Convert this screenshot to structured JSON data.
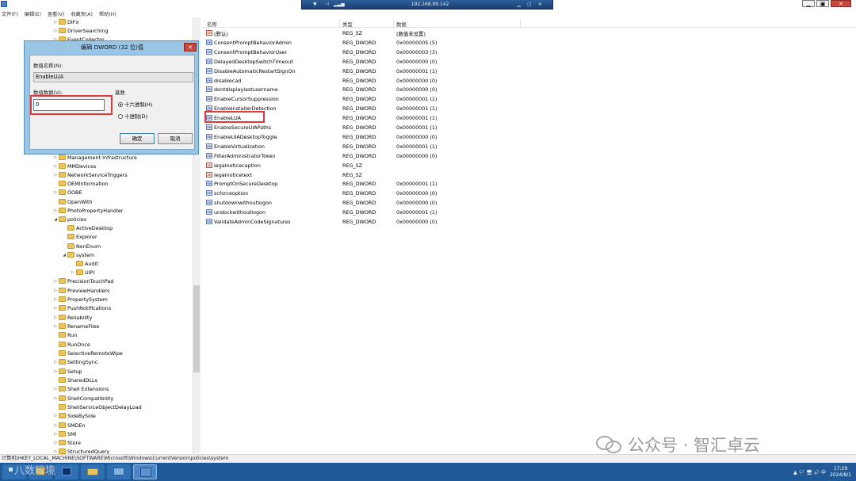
{
  "rdp_bar": {
    "pin_icon": "pin-icon",
    "signal_icon": "signal-icon",
    "host": "192.168.99.142"
  },
  "window_controls": {
    "minimize": "▁",
    "restore": "▣",
    "close": "✕"
  },
  "menu": [
    "文件(F)",
    "编辑(E)",
    "查看(V)",
    "收藏夹(A)",
    "帮助(H)"
  ],
  "tree": {
    "items": [
      {
        "label": "DIFx",
        "level": 0,
        "expander": "▷"
      },
      {
        "label": "DriverSearching",
        "level": 0,
        "expander": "▷"
      },
      {
        "label": "EventCollector",
        "level": 0,
        "expander": "▷"
      },
      {
        "label": "Management Infrastructure",
        "level": 0,
        "expander": "▷"
      },
      {
        "label": "MMDevices",
        "level": 0,
        "expander": "▷"
      },
      {
        "label": "NetworkServiceTriggers",
        "level": 0,
        "expander": "▷"
      },
      {
        "label": "OEMInformation",
        "level": 0,
        "expander": ""
      },
      {
        "label": "OOBE",
        "level": 0,
        "expander": "▷"
      },
      {
        "label": "OpenWith",
        "level": 0,
        "expander": ""
      },
      {
        "label": "PhotoPropertyHandler",
        "level": 0,
        "expander": "▷"
      },
      {
        "label": "policies",
        "level": 0,
        "expander": "◢"
      },
      {
        "label": "ActiveDesktop",
        "level": 1,
        "expander": ""
      },
      {
        "label": "Explorer",
        "level": 1,
        "expander": ""
      },
      {
        "label": "NonEnum",
        "level": 1,
        "expander": ""
      },
      {
        "label": "system",
        "level": 1,
        "expander": "◢"
      },
      {
        "label": "Audit",
        "level": 2,
        "expander": ""
      },
      {
        "label": "UIPI",
        "level": 2,
        "expander": "▷"
      },
      {
        "label": "PrecisionTouchPad",
        "level": 0,
        "expander": "▷"
      },
      {
        "label": "PreviewHandlers",
        "level": 0,
        "expander": "▷"
      },
      {
        "label": "PropertySystem",
        "level": 0,
        "expander": "▷"
      },
      {
        "label": "PushNotifications",
        "level": 0,
        "expander": "▷"
      },
      {
        "label": "Reliability",
        "level": 0,
        "expander": "▷"
      },
      {
        "label": "RenameFiles",
        "level": 0,
        "expander": "▷"
      },
      {
        "label": "Run",
        "level": 0,
        "expander": ""
      },
      {
        "label": "RunOnce",
        "level": 0,
        "expander": ""
      },
      {
        "label": "SelectiveRemoteWipe",
        "level": 0,
        "expander": ""
      },
      {
        "label": "SettingSync",
        "level": 0,
        "expander": "▷"
      },
      {
        "label": "Setup",
        "level": 0,
        "expander": "▷"
      },
      {
        "label": "SharedDLLs",
        "level": 0,
        "expander": ""
      },
      {
        "label": "Shell Extensions",
        "level": 0,
        "expander": "▷"
      },
      {
        "label": "ShellCompatibility",
        "level": 0,
        "expander": "▷"
      },
      {
        "label": "ShellServiceObjectDelayLoad",
        "level": 0,
        "expander": ""
      },
      {
        "label": "SideBySide",
        "level": 0,
        "expander": "▷"
      },
      {
        "label": "SMDEn",
        "level": 0,
        "expander": "▷"
      },
      {
        "label": "SMI",
        "level": 0,
        "expander": "▷"
      },
      {
        "label": "Store",
        "level": 0,
        "expander": "▷"
      },
      {
        "label": "StructuredQuery",
        "level": 0,
        "expander": "▷"
      }
    ]
  },
  "list": {
    "headers": {
      "name": "名称",
      "type": "类型",
      "data": "数据"
    },
    "rows": [
      {
        "name": "(默认)",
        "type": "REG_SZ",
        "data": "(数值未设置)",
        "icon": "ab"
      },
      {
        "name": "ConsentPromptBehaviorAdmin",
        "type": "REG_DWORD",
        "data": "0x00000005 (5)",
        "icon": "dw"
      },
      {
        "name": "ConsentPromptBehaviorUser",
        "type": "REG_DWORD",
        "data": "0x00000003 (3)",
        "icon": "dw"
      },
      {
        "name": "DelayedDesktopSwitchTimeout",
        "type": "REG_DWORD",
        "data": "0x00000000 (0)",
        "icon": "dw"
      },
      {
        "name": "DisableAutomaticRestartSignOn",
        "type": "REG_DWORD",
        "data": "0x00000001 (1)",
        "icon": "dw"
      },
      {
        "name": "disablecad",
        "type": "REG_DWORD",
        "data": "0x00000000 (0)",
        "icon": "dw"
      },
      {
        "name": "dontdisplaylastusername",
        "type": "REG_DWORD",
        "data": "0x00000000 (0)",
        "icon": "dw"
      },
      {
        "name": "EnableCursorSuppression",
        "type": "REG_DWORD",
        "data": "0x00000001 (1)",
        "icon": "dw"
      },
      {
        "name": "EnableInstallerDetection",
        "type": "REG_DWORD",
        "data": "0x00000001 (1)",
        "icon": "dw"
      },
      {
        "name": "EnableLUA",
        "type": "REG_DWORD",
        "data": "0x00000001 (1)",
        "icon": "dw"
      },
      {
        "name": "EnableSecureUIAPaths",
        "type": "REG_DWORD",
        "data": "0x00000001 (1)",
        "icon": "dw"
      },
      {
        "name": "EnableUIADesktopToggle",
        "type": "REG_DWORD",
        "data": "0x00000000 (0)",
        "icon": "dw"
      },
      {
        "name": "EnableVirtualization",
        "type": "REG_DWORD",
        "data": "0x00000001 (1)",
        "icon": "dw"
      },
      {
        "name": "FilterAdministratorToken",
        "type": "REG_DWORD",
        "data": "0x00000000 (0)",
        "icon": "dw"
      },
      {
        "name": "legalnoticecaption",
        "type": "REG_SZ",
        "data": "",
        "icon": "ab"
      },
      {
        "name": "legalnoticetext",
        "type": "REG_SZ",
        "data": "",
        "icon": "ab"
      },
      {
        "name": "PromptOnSecureDesktop",
        "type": "REG_DWORD",
        "data": "0x00000001 (1)",
        "icon": "dw"
      },
      {
        "name": "scforceoption",
        "type": "REG_DWORD",
        "data": "0x00000000 (0)",
        "icon": "dw"
      },
      {
        "name": "shutdownwithoutlogon",
        "type": "REG_DWORD",
        "data": "0x00000000 (0)",
        "icon": "dw"
      },
      {
        "name": "undockwithoutlogon",
        "type": "REG_DWORD",
        "data": "0x00000001 (1)",
        "icon": "dw"
      },
      {
        "name": "ValidateAdminCodeSignatures",
        "type": "REG_DWORD",
        "data": "0x00000000 (0)",
        "icon": "dw"
      }
    ]
  },
  "dialog": {
    "title": "编辑 DWORD (32 位)值",
    "close": "✕",
    "value_name_label": "数值名称(N):",
    "value_name": "EnableLUA",
    "value_data_label": "数值数据(V):",
    "value_data": "0",
    "base_label": "基数",
    "hex_label": "十六进制(H)",
    "dec_label": "十进制(D)",
    "base_selected": "hex",
    "ok_label": "确定",
    "cancel_label": "取消"
  },
  "statusbar": {
    "path": "计算机\\HKEY_LOCAL_MACHINE\\SOFTWARE\\Microsoft\\Windows\\CurrentVersion\\policies\\system"
  },
  "taskbar": {
    "tray_text": "▲ 🏳 🖥 🔊 中",
    "clock_time": "17:29",
    "clock_date": "2024/8/1"
  },
  "watermark": {
    "text": "公众号 · 智汇卓云",
    "corner_text": "八数暗境"
  },
  "colors": {
    "highlight_box": "#e23a3a",
    "dialog_frame": "#9ac6e6",
    "taskbar": "#1f5a96"
  }
}
